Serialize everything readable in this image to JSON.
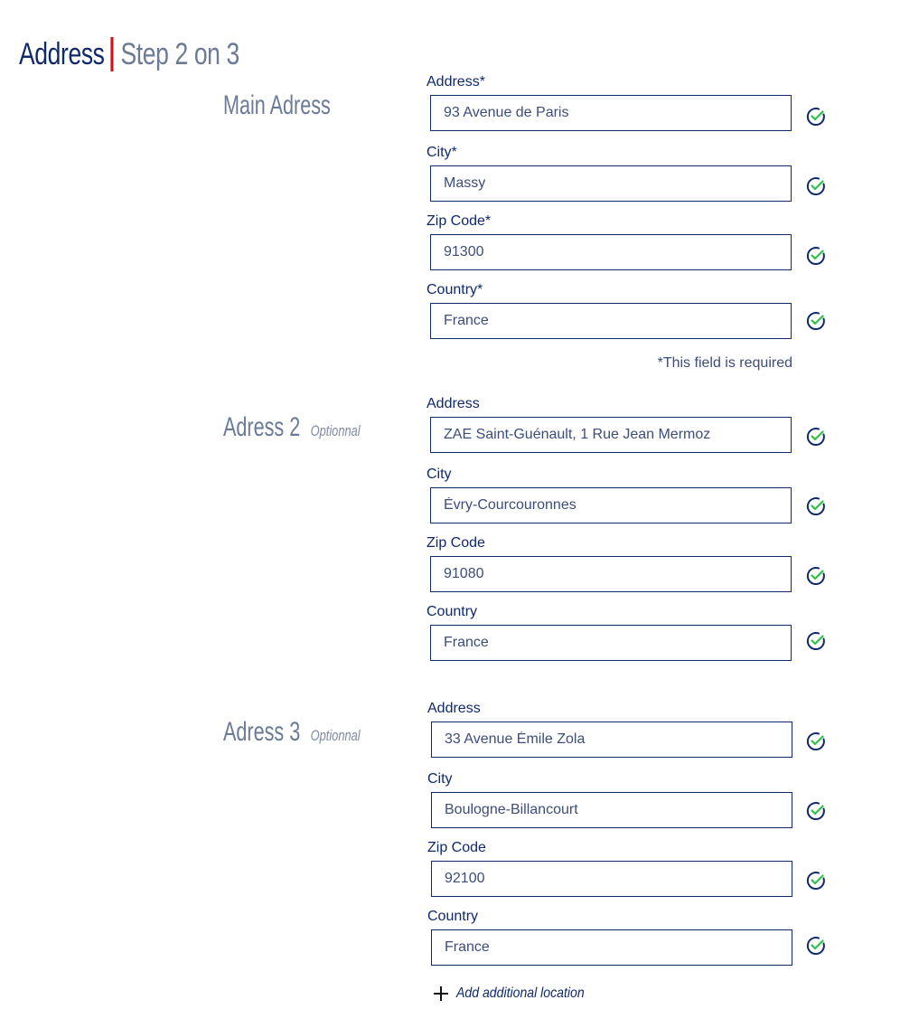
{
  "header": {
    "title": "Address",
    "step": "Step 2 on 3",
    "colors": {
      "primary": "#10296b",
      "accent": "#d0121b",
      "muted": "#6b7a96",
      "success": "#2fc24a"
    }
  },
  "sections": [
    {
      "label": "Main Adress",
      "optional_label": "",
      "fields": [
        {
          "label": "Address*",
          "value": "93 Avenue de Paris",
          "valid": true
        },
        {
          "label": "City*",
          "value": "Massy",
          "valid": true
        },
        {
          "label": "Zip Code*",
          "value": "91300",
          "valid": true
        },
        {
          "label": "Country*",
          "value": "France",
          "valid": true
        }
      ],
      "required_note": "*This field is required"
    },
    {
      "label": "Adress 2",
      "optional_label": "Optionnal",
      "fields": [
        {
          "label": "Address",
          "value": "ZAE Saint-Guénault, 1 Rue Jean Mermoz",
          "valid": true
        },
        {
          "label": "City",
          "value": "Évry-Courcouronnes",
          "valid": true
        },
        {
          "label": "Zip Code",
          "value": "91080",
          "valid": true
        },
        {
          "label": "Country",
          "value": "France",
          "valid": true
        }
      ]
    },
    {
      "label": "Adress 3",
      "optional_label": "Optionnal",
      "fields": [
        {
          "label": "Address",
          "value": "33 Avenue Émile Zola",
          "valid": true
        },
        {
          "label": "City",
          "value": "Boulogne-Billancourt",
          "valid": true
        },
        {
          "label": "Zip Code",
          "value": "92100",
          "valid": true
        },
        {
          "label": "Country",
          "value": "France",
          "valid": true
        }
      ]
    }
  ],
  "add_location": {
    "label": "Add additional location",
    "icon": "plus-icon"
  },
  "icons": {
    "valid": "check-circle-icon"
  }
}
